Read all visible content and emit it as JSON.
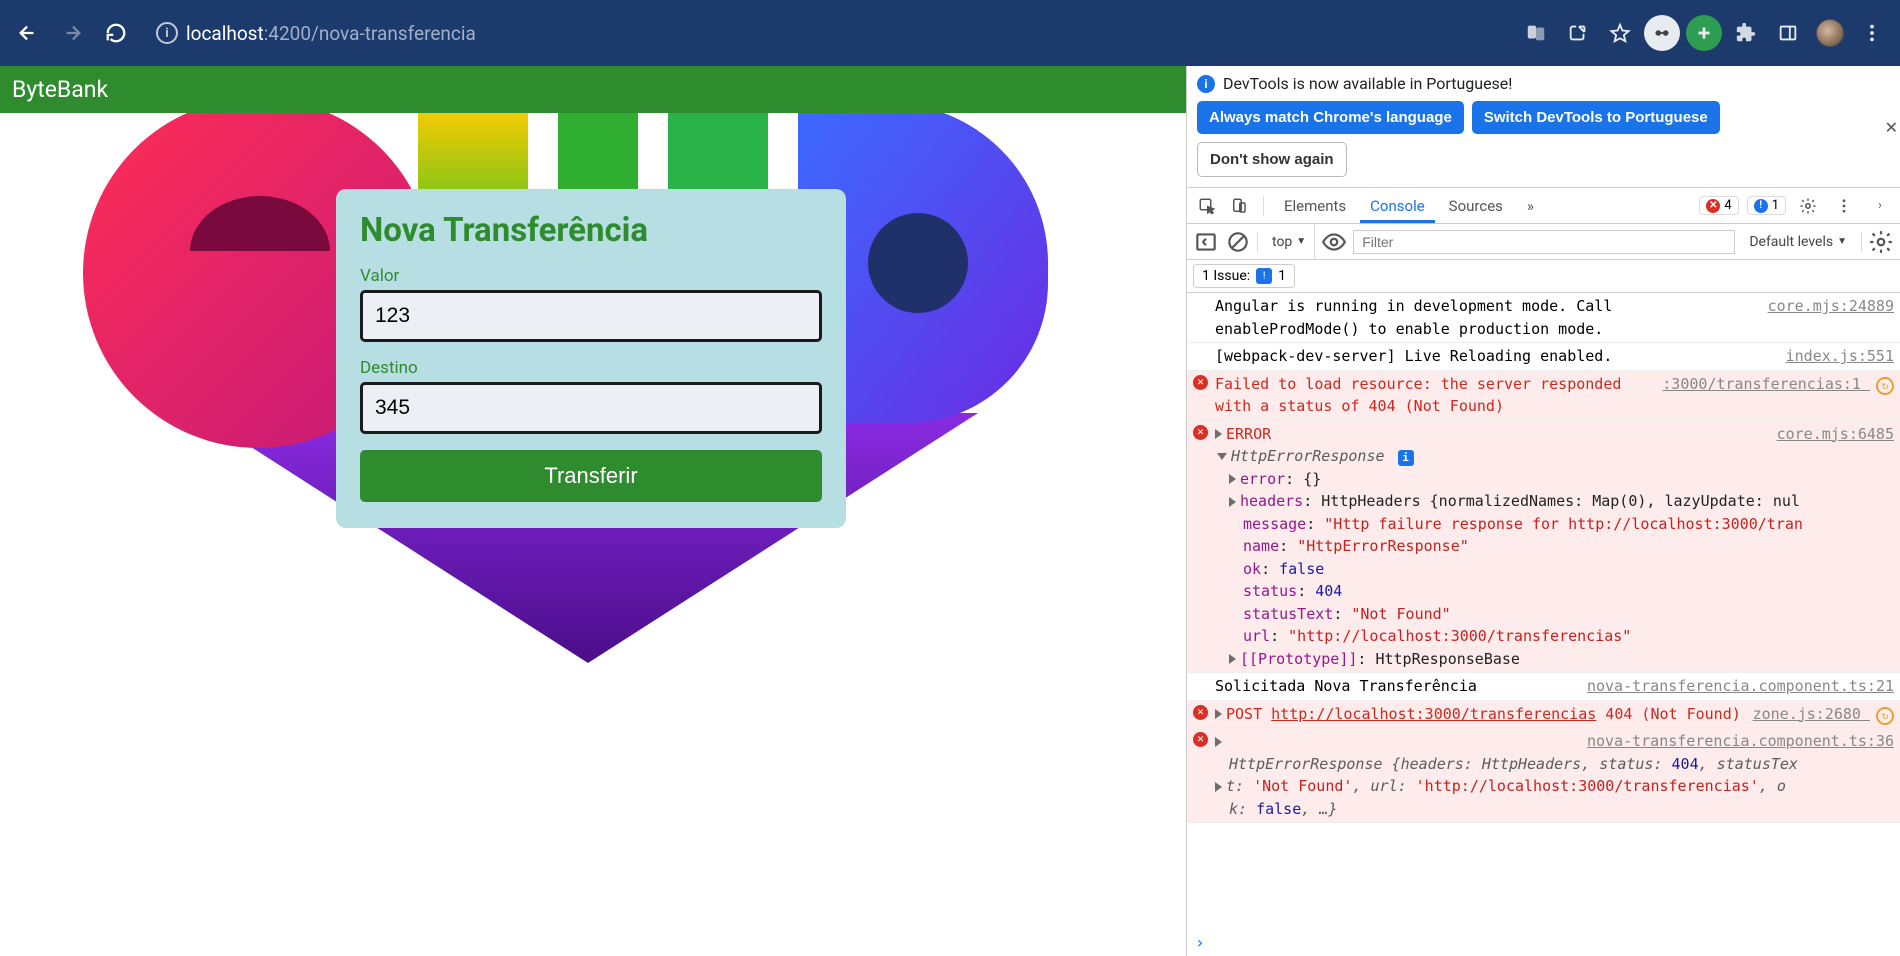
{
  "browser": {
    "url_host": "localhost",
    "url_port": ":4200",
    "url_path": "/nova-transferencia"
  },
  "app": {
    "title": "ByteBank",
    "card_title": "Nova Transferência",
    "valor_label": "Valor",
    "valor_value": "123",
    "destino_label": "Destino",
    "destino_value": "345",
    "submit_label": "Transferir"
  },
  "devtools": {
    "infobar_text": "DevTools is now available in Portuguese!",
    "btn_always": "Always match Chrome's language",
    "btn_switch": "Switch DevTools to Portuguese",
    "btn_dont": "Don't show again",
    "tabs": {
      "elements": "Elements",
      "console": "Console",
      "sources": "Sources",
      "more": "»"
    },
    "errors_count": "4",
    "issues_badge": "1",
    "top_label": "top",
    "filter_placeholder": "Filter",
    "levels_label": "Default levels",
    "issues_label": "1 Issue:",
    "issues_count": "1"
  },
  "logs": {
    "l1_msg": "Angular is running in development mode. Call enableProdMode() to enable production mode.",
    "l1_src": "core.mjs:24889",
    "l2_msg": "[webpack-dev-server] Live Reloading enabled.",
    "l2_src": "index.js:551",
    "l3_msg": "Failed to load resource: the server responded with a status of 404 (Not Found)",
    "l3_src": ":3000/transferencias:1",
    "l4_err": "ERROR",
    "l4_src": "core.mjs:6485",
    "l4_obj_name": "HttpErrorResponse",
    "l4_error_k": "error",
    "l4_error_v": "{}",
    "l4_headers_k": "headers",
    "l4_headers_v": "HttpHeaders {normalizedNames: Map(0), lazyUpdate: nul",
    "l4_message_k": "message",
    "l4_message_v": "\"Http failure response for http://localhost:3000/tran",
    "l4_name_k": "name",
    "l4_name_v": "\"HttpErrorResponse\"",
    "l4_ok_k": "ok",
    "l4_ok_v": "false",
    "l4_status_k": "status",
    "l4_status_v": "404",
    "l4_statusText_k": "statusText",
    "l4_statusText_v": "\"Not Found\"",
    "l4_url_k": "url",
    "l4_url_v": "\"http://localhost:3000/transferencias\"",
    "l4_proto_k": "[[Prototype]]",
    "l4_proto_v": "HttpResponseBase",
    "l5_msg": "Solicitada Nova Transferência",
    "l5_src": "nova-transferencia.component.ts:21",
    "l6_method": "POST",
    "l6_url": "http://localhost:3000/transferencias",
    "l6_status": "404 (Not Found)",
    "l6_src": "zone.js:2680",
    "l7_src": "nova-transferencia.component.ts:36",
    "l7_line1a": "HttpErrorResponse {headers: ",
    "l7_line1b": "HttpHeaders",
    "l7_line1c": ", status: ",
    "l7_line1d": "404",
    "l7_line1e": ", statusTex",
    "l7_line2a": "t: ",
    "l7_line2b": "'Not Found'",
    "l7_line2c": ", url: ",
    "l7_line2d": "'http://localhost:3000/transferencias'",
    "l7_line2e": ", o",
    "l7_line3a": "k: ",
    "l7_line3b": "false",
    "l7_line3c": ", …}",
    "prompt": "›"
  }
}
